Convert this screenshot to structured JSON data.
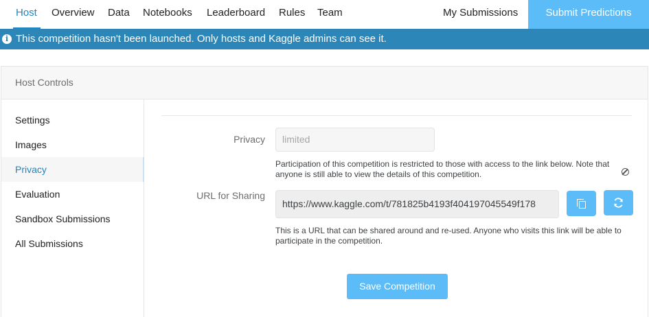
{
  "nav": {
    "tabs": [
      {
        "label": "Host"
      },
      {
        "label": "Overview"
      },
      {
        "label": "Data"
      },
      {
        "label": "Notebooks"
      },
      {
        "label": "Leaderboard"
      },
      {
        "label": "Rules"
      },
      {
        "label": "Team"
      }
    ],
    "active_tab": "Host",
    "my_submissions": "My Submissions",
    "submit_predictions": "Submit Predictions"
  },
  "banner": {
    "icon": "info-icon",
    "text": "This competition hasn't been launched. Only hosts and Kaggle admins can see it."
  },
  "host_controls": {
    "title": "Host Controls",
    "sidebar": [
      {
        "label": "Settings"
      },
      {
        "label": "Images"
      },
      {
        "label": "Privacy"
      },
      {
        "label": "Evaluation"
      },
      {
        "label": "Sandbox Submissions"
      },
      {
        "label": "All Submissions"
      }
    ],
    "active_item": "Privacy"
  },
  "privacy_form": {
    "privacy_label": "Privacy",
    "privacy_value": "limited",
    "privacy_help": "Participation of this competition is restricted to those with access to the link below. Note that anyone is still able to view the details of this competition.",
    "url_label": "URL for Sharing",
    "url_value": "https://www.kaggle.com/t/781825b4193f404197045549f178",
    "url_help": "This is a URL that can be shared around and re-used. Anyone who visits this link will be able to participate in the competition.",
    "save_button": "Save Competition"
  },
  "colors": {
    "accent": "#1b86c4",
    "banner_bg": "#2c86b8",
    "button_bg": "#5bbcf7"
  }
}
